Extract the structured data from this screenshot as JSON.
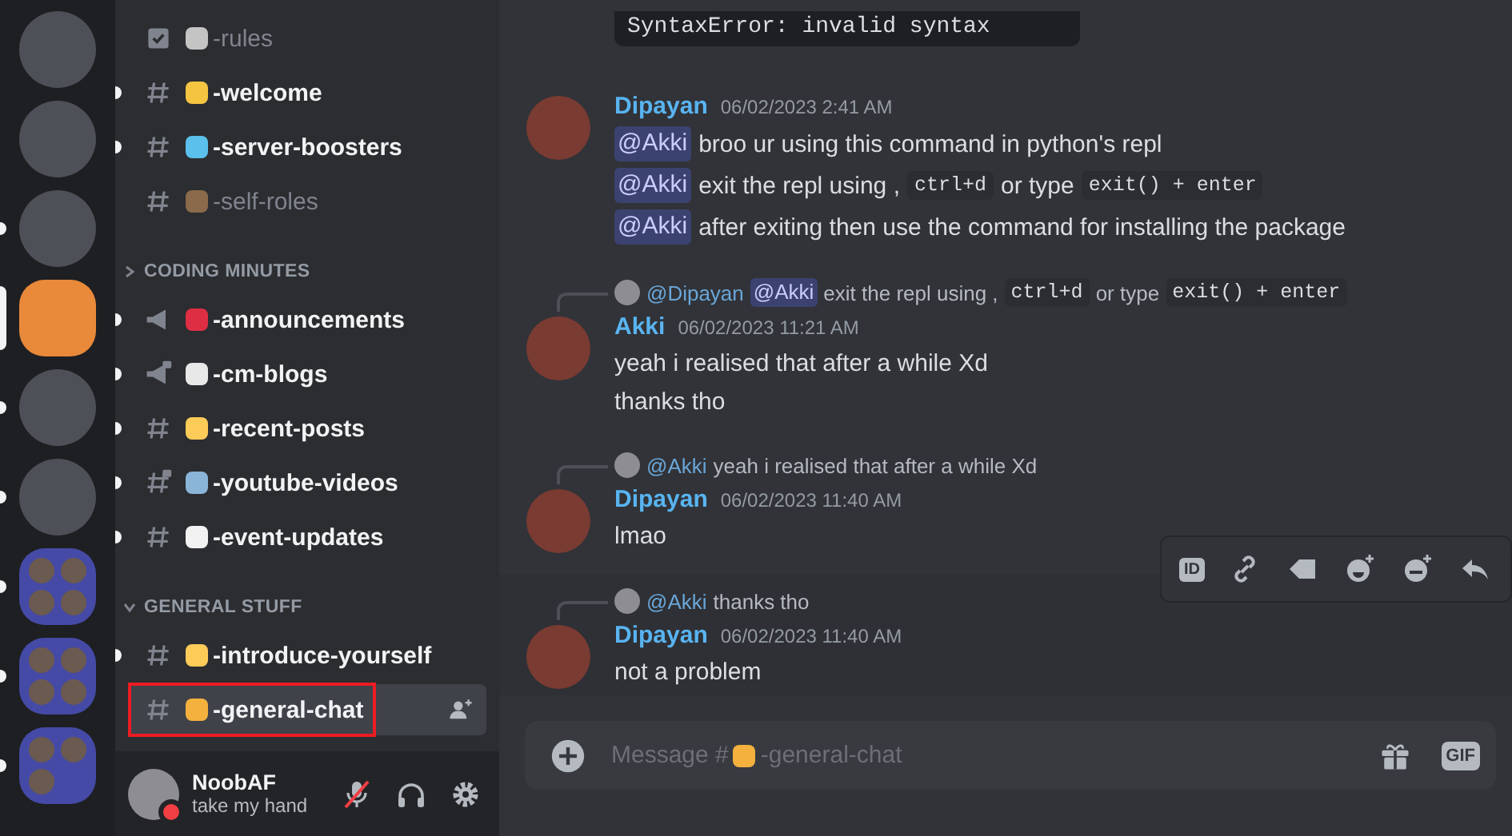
{
  "servers": [
    {
      "kind": "icon",
      "unread": false,
      "selected": false
    },
    {
      "kind": "icon",
      "unread": false,
      "selected": false
    },
    {
      "kind": "icon",
      "unread": true,
      "selected": false
    },
    {
      "kind": "icon",
      "selected": true
    },
    {
      "kind": "icon",
      "unread": true,
      "selected": false
    },
    {
      "kind": "icon",
      "unread": true,
      "selected": false
    },
    {
      "kind": "folder",
      "unread": true,
      "selected": false,
      "children": [
        {
          "kind": "icon"
        },
        {
          "kind": "icon"
        },
        {
          "kind": "icon"
        },
        {
          "kind": "icon"
        }
      ]
    },
    {
      "kind": "folder",
      "unread": true,
      "selected": false,
      "children": [
        {
          "kind": "icon"
        },
        {
          "kind": "icon"
        },
        {
          "kind": "icon"
        },
        {
          "kind": "icon"
        }
      ]
    },
    {
      "kind": "folder",
      "unread": true,
      "selected": false,
      "children": [
        {
          "kind": "icon"
        },
        {
          "kind": "icon"
        },
        {
          "kind": "icon"
        }
      ]
    }
  ],
  "sections": [
    {
      "channels": [
        {
          "kind": "rules",
          "name": "-rules",
          "color": "#c4c4c4",
          "unread": false,
          "selected": false,
          "annotated": false
        },
        {
          "kind": "text",
          "name": "-welcome",
          "color": "#f5c542",
          "unread": true,
          "locked": false,
          "selected": false,
          "annotated": false
        },
        {
          "kind": "text",
          "name": "-server-boosters",
          "color": "#5bc0eb",
          "unread": true,
          "locked": false,
          "selected": false,
          "annotated": false
        },
        {
          "kind": "text",
          "name": "-self-roles",
          "color": "#8a6a4a",
          "unread": false,
          "locked": false,
          "selected": false,
          "annotated": false
        }
      ]
    },
    {
      "category": "CODING MINUTES",
      "expanded": false,
      "channels": [
        {
          "kind": "announcement",
          "name": "-announcements",
          "color": "#dd2e44",
          "unread": true,
          "locked": false,
          "selected": false,
          "annotated": false
        },
        {
          "kind": "announcement",
          "name": "-cm-blogs",
          "color": "#e8e8e8",
          "unread": true,
          "locked": true,
          "selected": false,
          "annotated": false
        },
        {
          "kind": "text",
          "name": "-recent-posts",
          "color": "#fdcb58",
          "unread": true,
          "locked": false,
          "selected": false,
          "annotated": false
        },
        {
          "kind": "text",
          "name": "-youtube-videos",
          "color": "#8ab4d8",
          "unread": true,
          "locked": true,
          "selected": false,
          "annotated": false
        },
        {
          "kind": "text",
          "name": "-event-updates",
          "color": "#f2f2f2",
          "unread": true,
          "locked": false,
          "selected": false,
          "annotated": false
        }
      ]
    },
    {
      "category": "GENERAL STUFF",
      "expanded": true,
      "channels": [
        {
          "kind": "text",
          "name": "-introduce-yourself",
          "color": "#fdcb58",
          "unread": true,
          "locked": false,
          "selected": false,
          "annotated": false
        },
        {
          "kind": "text",
          "name": "-general-chat",
          "color": "#f4b13e",
          "unread": false,
          "locked": false,
          "selected": true,
          "annotated": true
        }
      ]
    }
  ],
  "user": {
    "name": "NoobAF",
    "status_text": "take my hand",
    "do_not_disturb": true,
    "muted": true
  },
  "code_block": {
    "text": "SyntaxError: invalid syntax"
  },
  "messages": [
    {
      "author": "Dipayan",
      "time": "06/02/2023 2:41 AM",
      "hovered": false,
      "lines": [
        [
          {
            "kind": "mention",
            "text": "@Akki"
          },
          {
            "kind": "text",
            "text": "broo ur using this command in python's repl"
          }
        ],
        [
          {
            "kind": "mention",
            "text": "@Akki"
          },
          {
            "kind": "text",
            "text": "exit the repl using ,"
          },
          {
            "kind": "code",
            "text": "ctrl+d"
          },
          {
            "kind": "text",
            "text": "or type"
          },
          {
            "kind": "code",
            "text": "exit() + enter"
          }
        ],
        [
          {
            "kind": "mention",
            "text": "@Akki"
          },
          {
            "kind": "text",
            "text": "after exiting then use the command for installing the package"
          }
        ]
      ]
    },
    {
      "author": "Akki",
      "time": "06/02/2023 11:21 AM",
      "hovered": false,
      "reply": {
        "author": "@Dipayan",
        "segments": [
          {
            "kind": "mention",
            "text": "@Akki"
          },
          {
            "kind": "text",
            "text": "exit the repl using ,"
          },
          {
            "kind": "code",
            "text": "ctrl+d"
          },
          {
            "kind": "text",
            "text": "or type"
          },
          {
            "kind": "code",
            "text": "exit() + enter"
          }
        ]
      },
      "lines": [
        [
          {
            "kind": "text",
            "text": "yeah i realised that after a while Xd"
          }
        ],
        [
          {
            "kind": "text",
            "text": "thanks tho"
          }
        ]
      ]
    },
    {
      "author": "Dipayan",
      "time": "06/02/2023 11:40 AM",
      "hovered": false,
      "reply": {
        "author": "@Akki",
        "segments": [
          {
            "kind": "text",
            "text": "yeah i realised that after a while Xd"
          }
        ]
      },
      "lines": [
        [
          {
            "kind": "text",
            "text": "lmao"
          }
        ]
      ]
    },
    {
      "author": "Dipayan",
      "time": "06/02/2023 11:40 AM",
      "hovered": true,
      "reply": {
        "author": "@Akki",
        "segments": [
          {
            "kind": "text",
            "text": "thanks tho"
          }
        ]
      },
      "lines": [
        [
          {
            "kind": "text",
            "text": "not a problem"
          }
        ]
      ]
    }
  ],
  "toolbar": {
    "id_label": "ID"
  },
  "composer": {
    "placeholder_prefix": "Message #",
    "placeholder_channel": "-general-chat",
    "emoji": {
      "color": "#f4b13e"
    },
    "gif_label": "GIF"
  }
}
